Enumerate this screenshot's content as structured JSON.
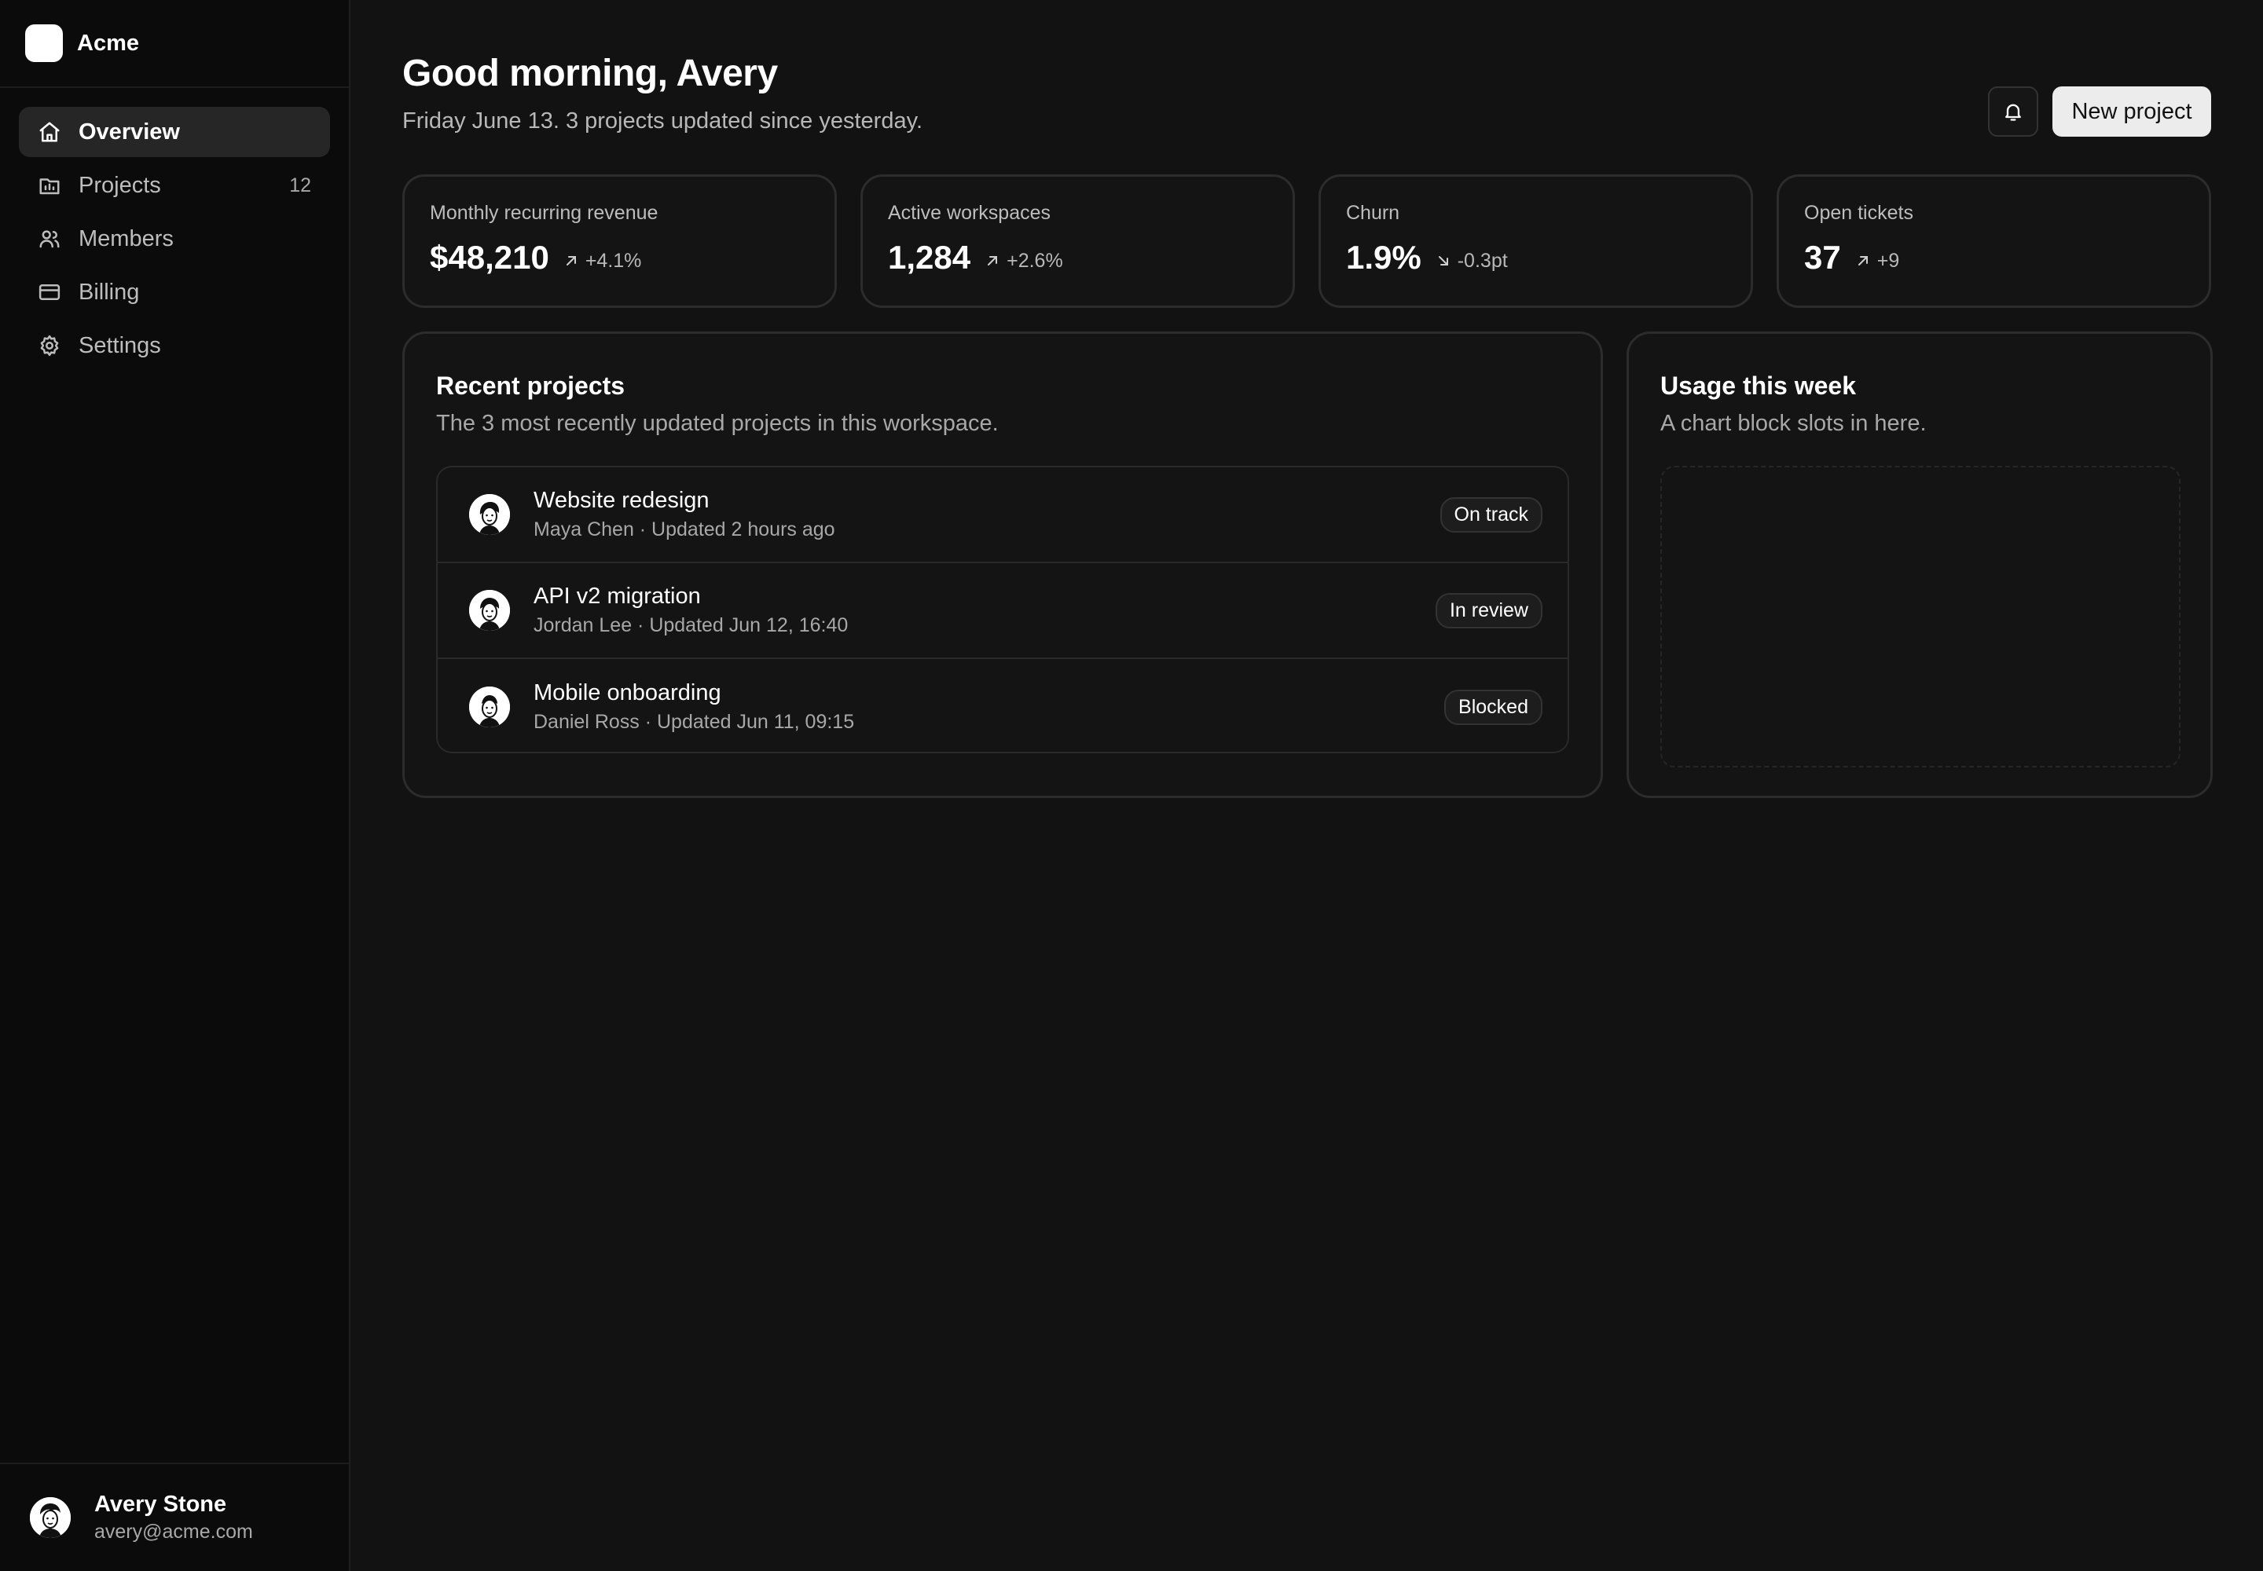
{
  "brand": {
    "name": "Acme"
  },
  "sidebar": {
    "items": [
      {
        "label": "Overview",
        "icon": "home-icon",
        "count": ""
      },
      {
        "label": "Projects",
        "icon": "folder-chart-icon",
        "count": "12"
      },
      {
        "label": "Members",
        "icon": "users-icon",
        "count": ""
      },
      {
        "label": "Billing",
        "icon": "credit-card-icon",
        "count": ""
      },
      {
        "label": "Settings",
        "icon": "gear-icon",
        "count": ""
      }
    ],
    "active": "Overview"
  },
  "user": {
    "name": "Avery Stone",
    "email": "avery@acme.com"
  },
  "header": {
    "greeting": "Good morning, Avery",
    "subtitle": "Friday June 13. 3 projects updated since yesterday.",
    "new_project_label": "New project",
    "bell_icon": "bell-icon"
  },
  "stats": [
    {
      "label": "Monthly recurring revenue",
      "value": "$48,210",
      "delta": "+4.1%",
      "direction": "up"
    },
    {
      "label": "Active workspaces",
      "value": "1,284",
      "delta": "+2.6%",
      "direction": "up"
    },
    {
      "label": "Churn",
      "value": "1.9%",
      "delta": "-0.3pt",
      "direction": "down"
    },
    {
      "label": "Open tickets",
      "value": "37",
      "delta": "+9",
      "direction": "up"
    }
  ],
  "recent": {
    "title": "Recent projects",
    "subtitle": "The 3 most recently updated projects in this workspace.",
    "projects": [
      {
        "title": "Website redesign",
        "meta": "Maya Chen · Updated 2 hours ago",
        "status": "On track"
      },
      {
        "title": "API v2 migration",
        "meta": "Jordan Lee · Updated Jun 12, 16:40",
        "status": "In review"
      },
      {
        "title": "Mobile onboarding",
        "meta": "Daniel Ross · Updated Jun 11, 09:15",
        "status": "Blocked"
      }
    ]
  },
  "usage": {
    "title": "Usage this week",
    "subtitle": "A chart block slots in here."
  },
  "colors": {
    "background": "#121212",
    "sidebar": "#0b0b0b",
    "card_border": "#2c2c2c",
    "primary_button": "#ececec"
  }
}
